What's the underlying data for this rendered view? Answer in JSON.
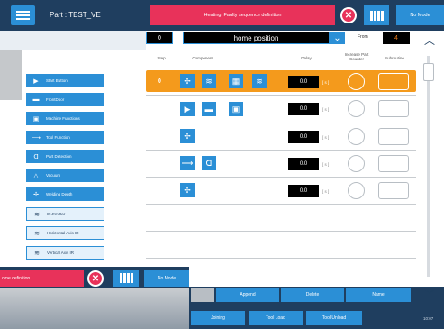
{
  "header": {
    "part_label": "Part : TEST_VE",
    "alarm": "Heating: Faulty sequence definition",
    "mode_label": "No Mode"
  },
  "sequence": {
    "number": "0",
    "name": "home position",
    "from_label": "From",
    "from_value": "4"
  },
  "columns": {
    "step": "Step",
    "component": "Component",
    "delay": "Delay",
    "increase": "Increase Part Counter",
    "subroutine": "Subroutine"
  },
  "tools": [
    {
      "label": "Start Button",
      "icon": "play-icon",
      "style": "dark"
    },
    {
      "label": "FrontDoor",
      "icon": "door-icon",
      "style": "dark"
    },
    {
      "label": "Machine Functions",
      "icon": "machine-icon",
      "style": "dark"
    },
    {
      "label": "Tool Function",
      "icon": "tool-icon",
      "style": "dark"
    },
    {
      "label": "Part Detection",
      "icon": "detection-icon",
      "style": "dark"
    },
    {
      "label": "Vacuum",
      "icon": "vacuum-icon",
      "style": "dark"
    },
    {
      "label": "Welding Depth",
      "icon": "depth-icon",
      "style": "dark"
    },
    {
      "label": "IR-Emitter",
      "icon": "ir-icon",
      "style": "light"
    },
    {
      "label": "Horizontal Axis IR",
      "icon": "ir-horizontal-icon",
      "style": "light"
    },
    {
      "label": "Vertical Axis IR",
      "icon": "ir-vertical-icon",
      "style": "light"
    }
  ],
  "steps": [
    {
      "num": "0",
      "delay": "0.0",
      "unit": "[ s ]"
    },
    {
      "num": "1",
      "delay": "0.0",
      "unit": "[ s ]"
    },
    {
      "num": "2",
      "delay": "0.0",
      "unit": "[ s ]"
    },
    {
      "num": "3",
      "delay": "0.0",
      "unit": "[ s ]"
    },
    {
      "num": "4",
      "delay": "0.0",
      "unit": "[ s ]"
    }
  ],
  "actions": {
    "append": "Append",
    "delete": "Delete",
    "name": "Name"
  },
  "bottom": {
    "joining": "Joining",
    "tool_load": "Tool Load",
    "tool_unload": "Tool Unload",
    "clock": "10:07"
  },
  "overlay": {
    "alarm": "ome definition",
    "mode_label": "No Mode"
  },
  "colors": {
    "navy": "#1f3e5f",
    "blue": "#2b8fd6",
    "alarm": "#e8325a",
    "active": "#f49a1c"
  }
}
